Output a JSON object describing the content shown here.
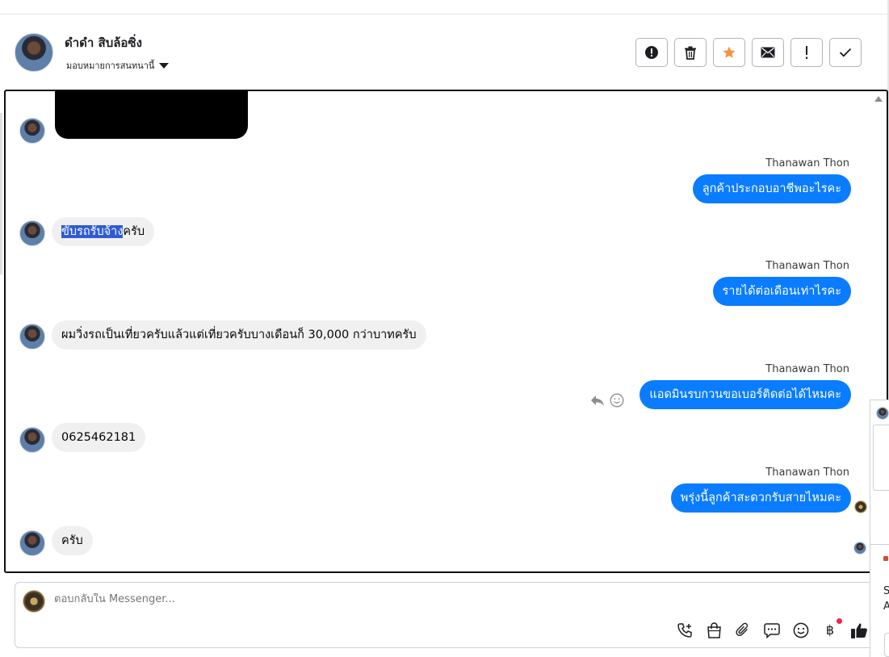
{
  "header": {
    "name": "ดำดำ สิบล้อซิ่ง",
    "assign_label": "มอบหมายการสนทนานี้",
    "actions": [
      {
        "icon": "alert-circle-icon"
      },
      {
        "icon": "trash-icon"
      },
      {
        "icon": "star-icon",
        "color": "#f7923b"
      },
      {
        "icon": "envelope-icon"
      },
      {
        "icon": "exclamation-icon"
      },
      {
        "icon": "check-icon"
      }
    ]
  },
  "conversation": {
    "messages": [
      {
        "direction": "incoming",
        "type": "redacted-attachment"
      },
      {
        "direction": "outgoing",
        "sender": "Thanawan Thon",
        "text": "ลูกค้าประกอบอาชีพอะไรคะ"
      },
      {
        "direction": "incoming",
        "text_highlighted": "ขับรถรับจ้าง",
        "text_rest": "ครับ"
      },
      {
        "direction": "outgoing",
        "sender": "Thanawan Thon",
        "text": "รายได้ต่อเดือนเท่าไรคะ"
      },
      {
        "direction": "incoming",
        "text": "ผมวิ่งรถเป็นเที่ยวครับแล้วแต่เที่ยวครับบางเดือนก็ 30,000 กว่าบาทครับ"
      },
      {
        "direction": "outgoing",
        "sender": "Thanawan Thon",
        "text": "แอดมินรบกวนขอเบอร์ติดต่อได้ไหมคะ"
      },
      {
        "direction": "incoming",
        "text": "0625462181"
      },
      {
        "direction": "outgoing",
        "sender": "Thanawan Thon",
        "text": "พรุ่งนี้ลูกค้าสะดวกรับสายไหมคะ"
      },
      {
        "direction": "incoming",
        "text": "ครับ"
      }
    ]
  },
  "composer": {
    "placeholder": "ตอบกลับใน Messenger...",
    "tools": [
      "phone-plus-icon",
      "shopping-bag-icon",
      "paperclip-icon",
      "chat-bubble-icon",
      "smiley-icon",
      "baht-icon",
      "thumbs-up-icon"
    ],
    "baht_symbol": "฿"
  },
  "side_panel": {
    "letter_1": "S",
    "letter_2": "A"
  },
  "colors": {
    "outgoing_bubble": "#0a7cff",
    "incoming_bubble": "#f0f0f0",
    "highlight": "#2f5bd3",
    "notification_dot": "#f02849"
  }
}
